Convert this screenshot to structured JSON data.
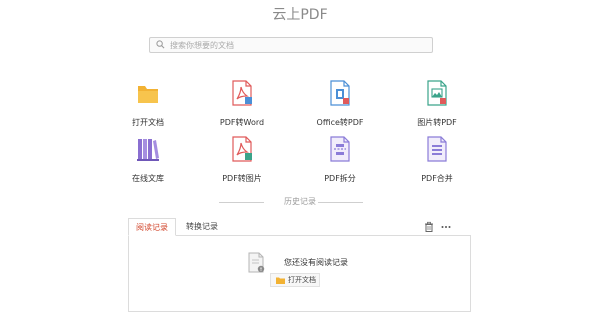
{
  "app": {
    "title": "云上PDF"
  },
  "search": {
    "placeholder": "搜索你想要的文档"
  },
  "tools": [
    {
      "label": "打开文档",
      "icon": "folder-icon"
    },
    {
      "label": "PDF转Word",
      "icon": "pdf-to-word-icon"
    },
    {
      "label": "Office转PDF",
      "icon": "office-to-pdf-icon"
    },
    {
      "label": "图片转PDF",
      "icon": "image-to-pdf-icon"
    },
    {
      "label": "在线文库",
      "icon": "library-icon"
    },
    {
      "label": "PDF转图片",
      "icon": "pdf-to-image-icon"
    },
    {
      "label": "PDF拆分",
      "icon": "pdf-split-icon"
    },
    {
      "label": "PDF合并",
      "icon": "pdf-merge-icon"
    }
  ],
  "history": {
    "label": "历史记录",
    "tabs": [
      {
        "label": "阅读记录",
        "active": true
      },
      {
        "label": "转换记录",
        "active": false
      }
    ],
    "empty_message": "您还没有阅读记录",
    "open_button": "打开文档"
  },
  "colors": {
    "accent": "#d2452b",
    "folder": "#f2b233",
    "pdf_red": "#e05a5a",
    "office_blue": "#4b8fd6",
    "image_green": "#3aa38a",
    "library_purple": "#8a6fd1",
    "split_purple": "#8b7cd8"
  }
}
